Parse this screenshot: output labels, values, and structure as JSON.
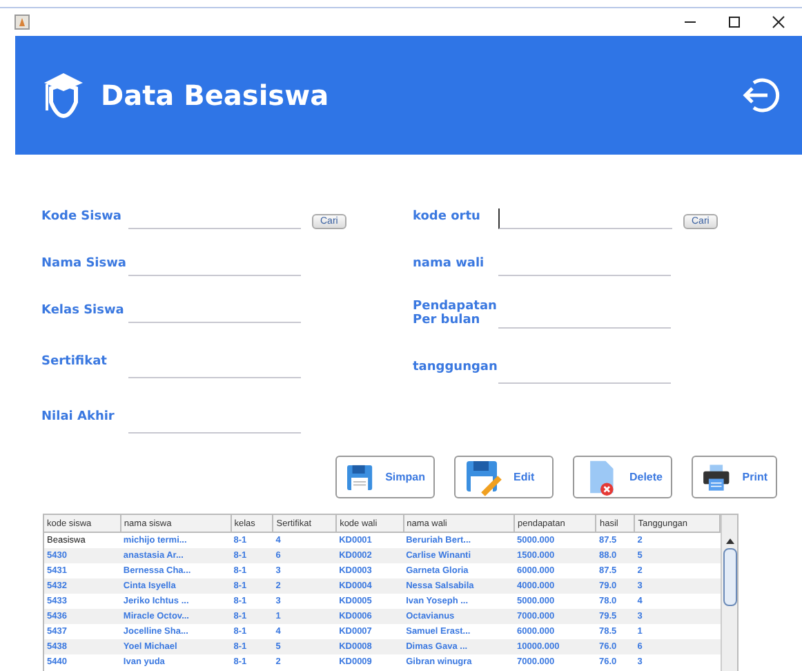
{
  "window": {
    "title": "Data Beasiswa"
  },
  "form_left": [
    {
      "label": "Kode Siswa",
      "button": "Cari"
    },
    {
      "label": "Nama Siswa"
    },
    {
      "label": "Kelas Siswa"
    },
    {
      "label": "Sertifikat"
    },
    {
      "label": "Nilai Akhir"
    }
  ],
  "form_right": [
    {
      "label": "kode ortu",
      "button": "Cari",
      "focused": true
    },
    {
      "label": "nama wali"
    },
    {
      "label": "Pendapatan Per bulan"
    },
    {
      "label": "tanggungan"
    }
  ],
  "actions": [
    {
      "label": "Simpan",
      "kind": "save"
    },
    {
      "label": "Edit",
      "kind": "edit"
    },
    {
      "label": "Delete",
      "kind": "delete"
    },
    {
      "label": "Print",
      "kind": "print"
    }
  ],
  "table": {
    "columns": [
      "kode siswa",
      "nama siswa",
      "kelas",
      "Sertifikat",
      "kode wali",
      "nama wali",
      "pendapatan",
      "hasil",
      "Tanggungan"
    ],
    "rows": [
      [
        "Beasiswa",
        "michijo termi...",
        "8-1",
        "4",
        "KD0001",
        "Beruriah Bert...",
        "5000.000",
        "87.5",
        "2"
      ],
      [
        "5430",
        "anastasia Ar...",
        "8-1",
        "6",
        "KD0002",
        "Carlise Winanti",
        "1500.000",
        "88.0",
        "5"
      ],
      [
        "5431",
        "Bernessa Cha...",
        "8-1",
        "3",
        "KD0003",
        "Garneta Gloria",
        "6000.000",
        "87.5",
        "2"
      ],
      [
        "5432",
        "Cinta Isyella",
        "8-1",
        "2",
        "KD0004",
        "Nessa Salsabila",
        "4000.000",
        "79.0",
        "3"
      ],
      [
        "5433",
        "Jeriko Ichtus ...",
        "8-1",
        "3",
        "KD0005",
        "Ivan Yoseph ...",
        "5000.000",
        "78.0",
        "4"
      ],
      [
        "5436",
        "Miracle Octov...",
        "8-1",
        "1",
        "KD0006",
        "Octavianus",
        "7000.000",
        "79.5",
        "3"
      ],
      [
        "5437",
        "Jocelline Sha...",
        "8-1",
        "4",
        "KD0007",
        "Samuel Erast...",
        "6000.000",
        "78.5",
        "1"
      ],
      [
        "5438",
        "Yoel Michael",
        "8-1",
        "5",
        "KD0008",
        "Dimas Gava ...",
        "10000.000",
        "76.0",
        "6"
      ],
      [
        "5440",
        "Ivan yuda",
        "8-1",
        "2",
        "KD0009",
        "Gibran winugra",
        "7000.000",
        "76.0",
        "3"
      ]
    ]
  }
}
